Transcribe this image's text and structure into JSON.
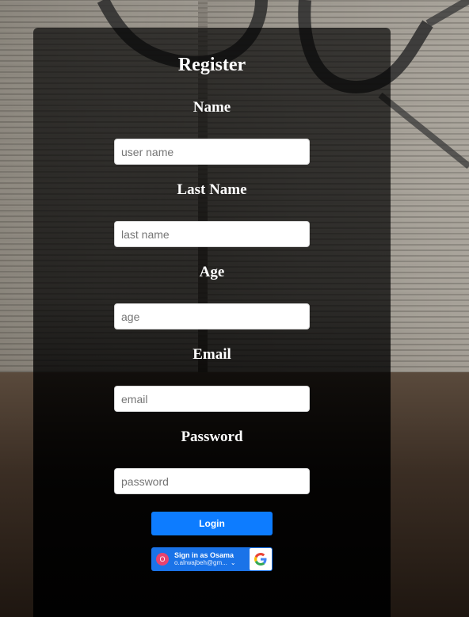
{
  "form": {
    "title": "Register",
    "fields": [
      {
        "label": "Name",
        "placeholder": "user name"
      },
      {
        "label": "Last Name",
        "placeholder": "last name"
      },
      {
        "label": "Age",
        "placeholder": "age"
      },
      {
        "label": "Email",
        "placeholder": "email"
      },
      {
        "label": "Password",
        "placeholder": "password"
      }
    ],
    "login_label": "Login"
  },
  "google_signin": {
    "avatar_initial": "O",
    "title": "Sign in as Osama",
    "email": "o.alrwajbeh@gm...",
    "icon": "google-g-icon"
  },
  "colors": {
    "login_button": "#0d7cff",
    "google_button": "#1a73e8",
    "avatar": "#e8436f"
  }
}
